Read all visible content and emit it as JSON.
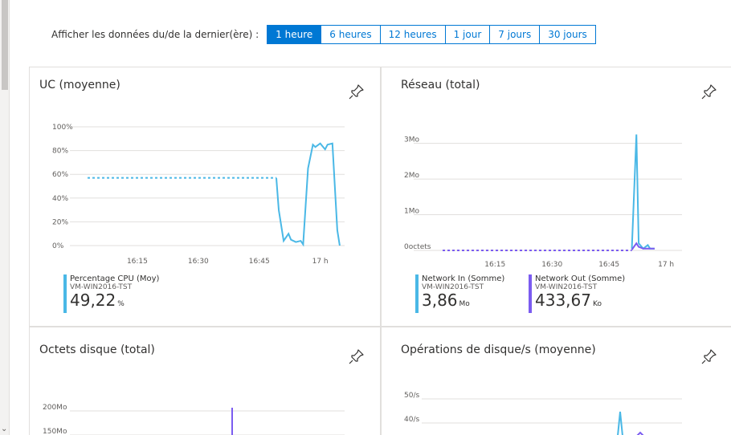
{
  "timeRange": {
    "label": "Afficher les données du/de la dernier(ère) :",
    "options": [
      "1 heure",
      "6 heures",
      "12 heures",
      "1 jour",
      "7 jours",
      "30 jours"
    ],
    "selected": "1 heure"
  },
  "colors": {
    "accent": "#0078d4",
    "seriesBlue": "#4ab8e6",
    "seriesPurple": "#7b5cf0"
  },
  "tiles": {
    "cpu": {
      "title": "UC (moyenne)",
      "legend": [
        {
          "name": "Percentage CPU (Moy)",
          "resource": "VM-WIN2016-TST",
          "value": "49,22",
          "unit": "%"
        }
      ]
    },
    "network": {
      "title": "Réseau (total)",
      "legend": [
        {
          "name": "Network In (Somme)",
          "resource": "VM-WIN2016-TST",
          "value": "3,86",
          "unit": "Mo"
        },
        {
          "name": "Network Out (Somme)",
          "resource": "VM-WIN2016-TST",
          "value": "433,67",
          "unit": "Ko"
        }
      ]
    },
    "disk": {
      "title": "Octets disque (total)"
    },
    "diskops": {
      "title": "Opérations de disque/s (moyenne)"
    }
  },
  "chart_data": [
    {
      "type": "line",
      "title": "UC (moyenne)",
      "yticks": [
        "100%",
        "80%",
        "60%",
        "40%",
        "20%",
        "0%"
      ],
      "xticks": [
        "16:15",
        "16:30",
        "16:45",
        "17 h"
      ],
      "ylim": [
        0,
        100
      ],
      "series": [
        {
          "name": "Percentage CPU (Moy)",
          "x": [
            16.82,
            16.83,
            16.85,
            16.87,
            16.88,
            16.9,
            16.92,
            16.93,
            16.95,
            16.97,
            16.98,
            17.0,
            17.02,
            17.03,
            17.05,
            17.07,
            17.08
          ],
          "y": [
            57,
            30,
            4,
            10,
            5,
            3,
            4,
            1,
            65,
            85,
            83,
            86,
            81,
            85,
            86,
            13,
            0
          ]
        }
      ]
    },
    {
      "type": "line",
      "title": "Réseau (total)",
      "yticks": [
        "3Mo",
        "2Mo",
        "1Mo",
        "0octets"
      ],
      "xticks": [
        "16:15",
        "16:30",
        "16:45",
        "17 h"
      ],
      "series": [
        {
          "name": "Network In (Somme)",
          "x": [
            16.85,
            16.87,
            16.88,
            16.9,
            16.92,
            16.93,
            16.95
          ],
          "y": [
            0.05,
            3.25,
            0.2,
            0.05,
            0.15,
            0.05,
            0.05
          ]
        },
        {
          "name": "Network Out (Somme)",
          "x": [
            16.85,
            16.87,
            16.88,
            16.9,
            16.92,
            16.93,
            16.95
          ],
          "y": [
            0.02,
            0.2,
            0.1,
            0.05,
            0.05,
            0.05,
            0.05
          ]
        }
      ]
    },
    {
      "type": "line",
      "title": "Octets disque (total)",
      "yticks": [
        "200Mo",
        "150Mo"
      ]
    },
    {
      "type": "line",
      "title": "Opérations de disque/s (moyenne)",
      "yticks": [
        "50/s",
        "40/s"
      ]
    }
  ]
}
